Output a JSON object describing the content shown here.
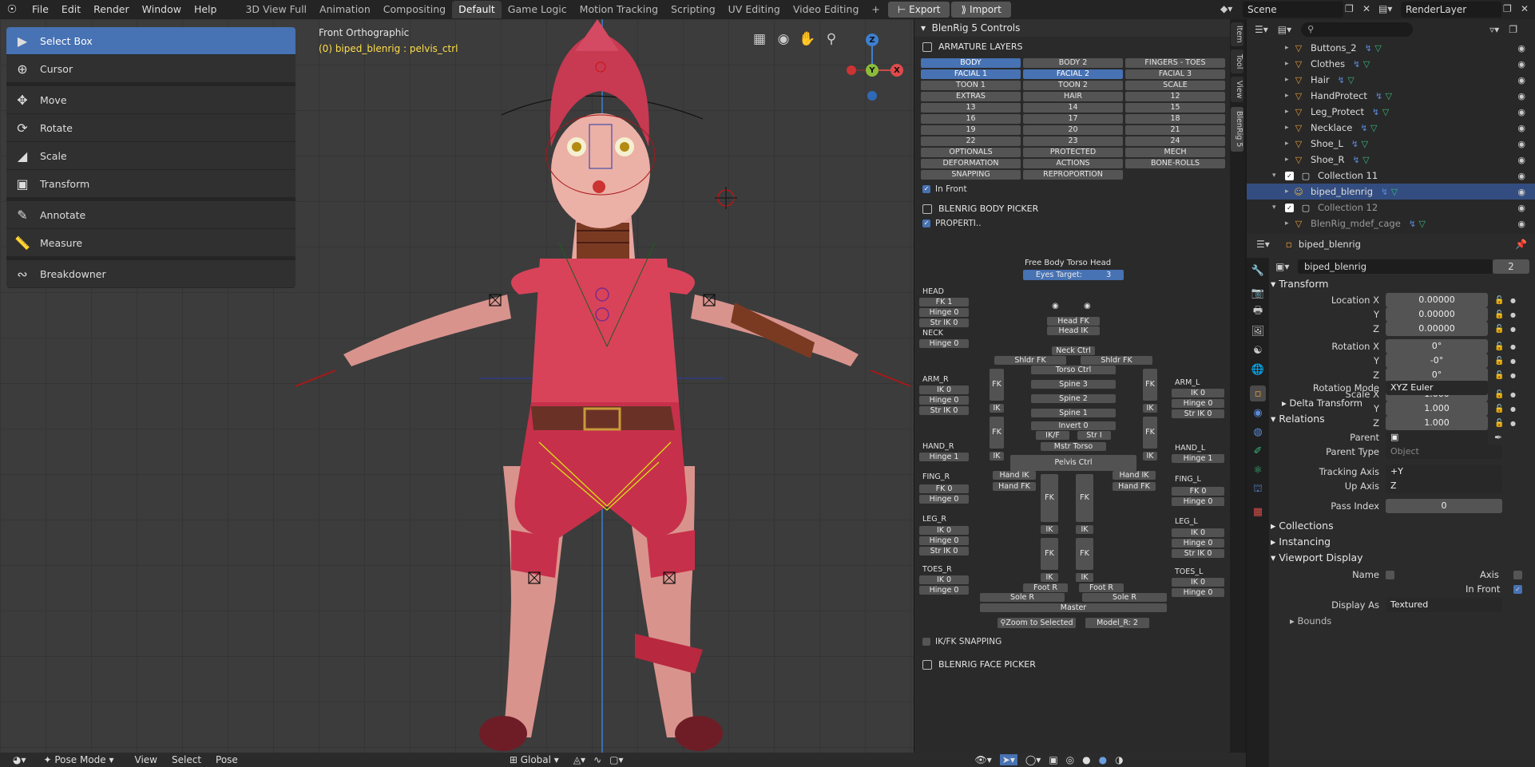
{
  "menu": {
    "items": [
      "File",
      "Edit",
      "Render",
      "Window",
      "Help"
    ]
  },
  "workspaces": {
    "tabs": [
      "3D View Full",
      "Animation",
      "Compositing",
      "Default",
      "Game Logic",
      "Motion Tracking",
      "Scripting",
      "UV Editing",
      "Video Editing"
    ],
    "active": "Default",
    "add": "+"
  },
  "toolbar_buttons": {
    "export": "Export",
    "import": "Import"
  },
  "scene": {
    "name": "Scene",
    "layer": "RenderLayer"
  },
  "tools": [
    "Select Box",
    "Cursor",
    "Move",
    "Rotate",
    "Scale",
    "Transform",
    "Annotate",
    "Measure",
    "Breakdowner"
  ],
  "viewport": {
    "title": "Front Orthographic",
    "subtitle": "(0) biped_blenrig : pelvis_ctrl",
    "gizmo": {
      "z": "Z",
      "y": "Y",
      "x": "X"
    }
  },
  "footer": {
    "mode": "Pose Mode",
    "view": "View",
    "select": "Select",
    "pose": "Pose",
    "orientation": "Global"
  },
  "rig_panel": {
    "title": "BlenRig 5 Controls",
    "armature_layers": "ARMATURE LAYERS",
    "layers": [
      "BODY",
      "BODY 2",
      "FINGERS - TOES",
      "FACIAL 1",
      "FACIAL 2",
      "FACIAL 3",
      "TOON 1",
      "TOON 2",
      "SCALE",
      "EXTRAS",
      "HAIR",
      "12",
      "13",
      "14",
      "15",
      "16",
      "17",
      "18",
      "19",
      "20",
      "21",
      "22",
      "23",
      "24",
      "OPTIONALS",
      "PROTECTED",
      "MECH",
      "DEFORMATION",
      "ACTIONS",
      "BONE-ROLLS",
      "SNAPPING",
      "REPROPORTION"
    ],
    "in_front": "In Front",
    "body_picker": "BLENRIG BODY PICKER",
    "properties": "PROPERTI..",
    "view_tabs": "Free  Body  Torso Head",
    "eyes_target": "Eyes Target:",
    "eyes_value": "3",
    "head": "HEAD",
    "fk1": "FK 1",
    "hinge0": "Hinge 0",
    "str_ik0": "Str IK 0",
    "neck": "NECK",
    "arm_r": "ARM_R",
    "arm_l": "ARM_L",
    "ik0": "IK 0",
    "hand_r": "HAND_R",
    "hand_l": "HAND_L",
    "hinge1": "Hinge 1",
    "fing_r": "FING_R",
    "fing_l": "FING_L",
    "fk0": "FK 0",
    "leg_r": "LEG_R",
    "leg_l": "LEG_L",
    "toes_r": "TOES_R",
    "toes_l": "TOES_L",
    "head_fk": "Head FK",
    "head_ik": "Head IK",
    "neck_ctrl": "Neck Ctrl",
    "shldr_fk": "Shldr FK",
    "ik": "IK",
    "fk": "FK",
    "torso_ctrl": "Torso Ctrl",
    "spine3": "Spine 3",
    "spine2": "Spine 2",
    "spine1": "Spine 1",
    "invert": "Invert 0",
    "ikf": "IK/F",
    "stri": "Str I",
    "mstr_torso": "Mstr Torso",
    "pelvis": "Pelvis Ctrl",
    "hand_ik": "Hand IK",
    "hand_fk": "Hand FK",
    "foot_r": "Foot R",
    "sole_r": "Sole R",
    "master": "Master",
    "zoom": "Zoom to Selected",
    "model": "Model_R: 2",
    "ikfk_snapping": "IK/FK SNAPPING",
    "face_picker": "BLENRIG FACE PICKER"
  },
  "side_tabs": [
    "Item",
    "Tool",
    "View",
    "BlenRig 5"
  ],
  "outliner": {
    "rows": [
      {
        "name": "Buttons_2",
        "depth": 2
      },
      {
        "name": "Clothes",
        "depth": 2
      },
      {
        "name": "Hair",
        "depth": 2
      },
      {
        "name": "HandProtect",
        "depth": 2
      },
      {
        "name": "Leg_Protect",
        "depth": 2
      },
      {
        "name": "Necklace",
        "depth": 2
      },
      {
        "name": "Shoe_L",
        "depth": 2
      },
      {
        "name": "Shoe_R",
        "depth": 2
      },
      {
        "name": "Collection 11",
        "depth": 1
      },
      {
        "name": "biped_blenrig",
        "depth": 2
      },
      {
        "name": "Collection 12",
        "depth": 1
      },
      {
        "name": "BlenRig_mdef_cage",
        "depth": 2
      }
    ]
  },
  "properties": {
    "object_name": "biped_blenrig",
    "datablock": "biped_blenrig",
    "users": "2",
    "transform": "Transform",
    "location": "Location X",
    "y": "Y",
    "z": "Z",
    "loc_x": "0.00000",
    "loc_y": "0.00000",
    "loc_z": "0.00000",
    "rotation": "Rotation X",
    "rot_x": "0°",
    "rot_y": "-0°",
    "rot_z": "0°",
    "scale": "Scale X",
    "sc_x": "1.000",
    "sc_y": "1.000",
    "sc_z": "1.000",
    "rotation_mode_label": "Rotation Mode",
    "rotation_mode": "XYZ Euler",
    "delta": "Delta Transform",
    "relations": "Relations",
    "parent": "Parent",
    "parent_type_label": "Parent Type",
    "parent_type": "Object",
    "tracking_axis_label": "Tracking Axis",
    "tracking_axis": "+Y",
    "up_axis_label": "Up Axis",
    "up_axis": "Z",
    "pass_index_label": "Pass Index",
    "pass_index": "0",
    "collections": "Collections",
    "instancing": "Instancing",
    "viewport_display": "Viewport Display",
    "name_label": "Name",
    "axis_label": "Axis",
    "in_front_label": "In Front",
    "display_as_label": "Display As",
    "display_as": "Textured",
    "bounds": "Bounds"
  }
}
